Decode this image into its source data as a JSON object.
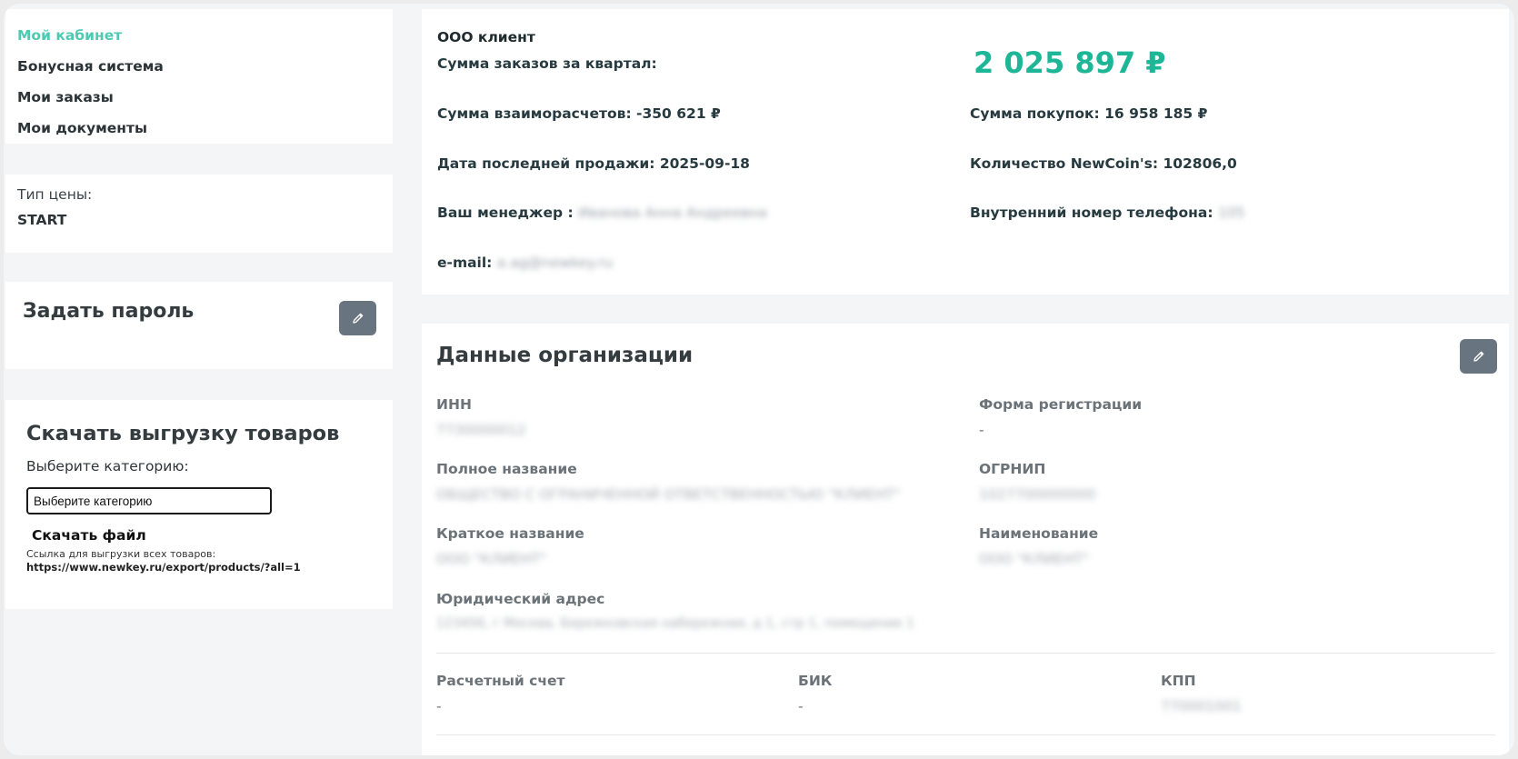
{
  "sidebar": {
    "menu": [
      {
        "label": "Мой кабинет"
      },
      {
        "label": "Бонусная система"
      },
      {
        "label": "Мои заказы"
      },
      {
        "label": "Мои документы"
      }
    ],
    "price_type_label": "Тип цены:",
    "price_type_value": "START"
  },
  "password": {
    "title": "Задать пароль"
  },
  "download": {
    "title": "Скачать выгрузку товаров",
    "category_label": "Выберите категорию:",
    "select_value": "Выберите категорию",
    "button_label": "Скачать файл",
    "note": "Ссылка для выгрузки всех товаров:",
    "link": "https://www.newkey.ru/export/products/?all=1"
  },
  "summary": {
    "client": "ООО клиент",
    "orders_label": "Сумма заказов за квартал:",
    "orders_amount": "2 025 897 ₽",
    "settlements": "Сумма взаиморасчетов: -350 621 ₽",
    "purchases": "Сумма покупок: 16 958 185 ₽",
    "last_sale": "Дата последней продажи: 2025-09-18",
    "newcoins": "Количество NewCoin's: 102806,0",
    "manager_label": "Ваш менеджер :",
    "manager_value": "Иванова Анна Андреевна",
    "phone_label": "Внутренний номер телефона:",
    "phone_value": "105",
    "email_label": "e-mail:",
    "email_value": "a.ag@newkey.ru"
  },
  "organization": {
    "title": "Данные организации",
    "inn_label": "ИНН",
    "inn_value": "7730000012",
    "reg_form_label": "Форма регистрации",
    "reg_form_value": "-",
    "full_name_label": "Полное название",
    "full_name_value": "ОБЩЕСТВО С ОГРАНИЧЕННОЙ ОТВЕТСТВЕННОСТЬЮ \"КЛИЕНТ\"",
    "ogrnip_label": "ОГРНИП",
    "ogrnip_value": "1027700000000",
    "short_name_label": "Краткое название",
    "short_name_value": "ООО \"КЛИЕНТ\"",
    "name_label": "Наименование",
    "name_value": "ООО \"КЛИЕНТ\"",
    "address_label": "Юридический адрес",
    "address_value": "123456, г Москва, Бережковская набережная, д 1, стр 1, помещение 1",
    "account_label": "Расчетный счет",
    "account_value": "-",
    "bik_label": "БИК",
    "bik_value": "-",
    "kpp_label": "КПП",
    "kpp_value": "770001001"
  },
  "colors": {
    "accent": "#4ecab3",
    "amount": "#1db696",
    "edit_button": "#687480"
  },
  "icons": {
    "edit": "pencil-icon"
  }
}
